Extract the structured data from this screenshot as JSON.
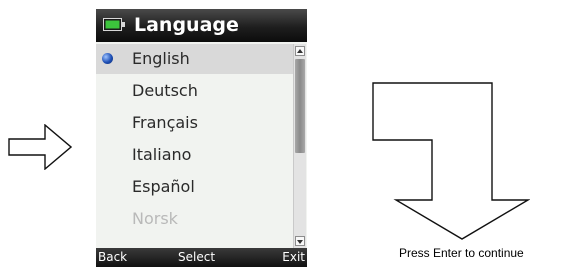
{
  "header": {
    "title": "Language",
    "icon": "battery-icon"
  },
  "languages": [
    {
      "label": "English",
      "selected": true,
      "enabled": true
    },
    {
      "label": "Deutsch",
      "selected": false,
      "enabled": true
    },
    {
      "label": "Français",
      "selected": false,
      "enabled": true
    },
    {
      "label": "Italiano",
      "selected": false,
      "enabled": true
    },
    {
      "label": "Español",
      "selected": false,
      "enabled": true
    },
    {
      "label": "Norsk",
      "selected": false,
      "enabled": false
    }
  ],
  "softkeys": {
    "back": "Back",
    "select": "Select",
    "exit": "Exit"
  },
  "instruction": "Press Enter to continue",
  "colors": {
    "title_bar": "#1e1e1e",
    "selection": "#d9d9d9",
    "list_background": "#f1f3f0",
    "bullet": "#1e4fb5",
    "battery": "#3cc43c"
  }
}
